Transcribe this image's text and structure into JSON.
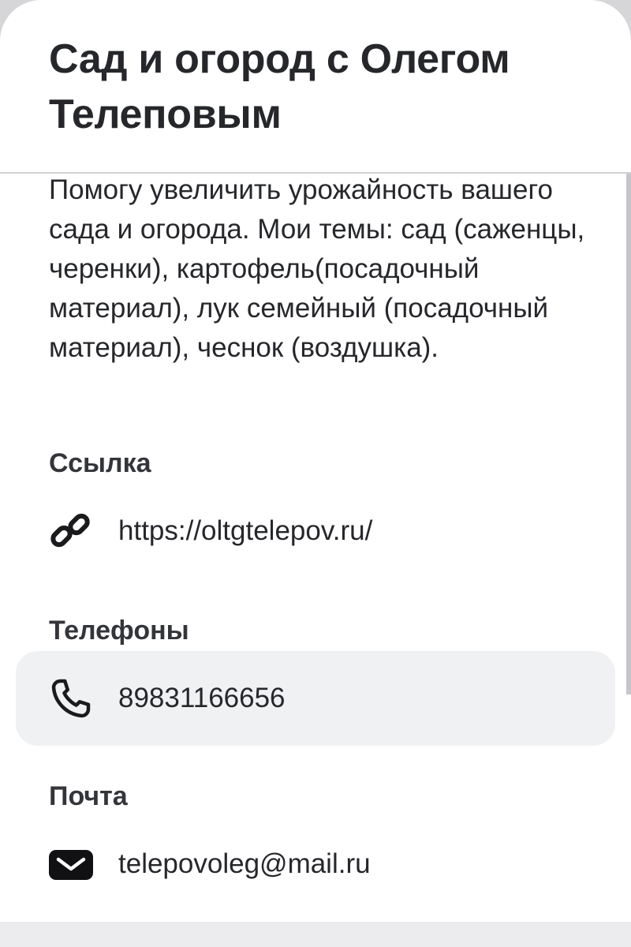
{
  "profile": {
    "title": "Сад и огород с Олегом Телеповым",
    "description": "Помогу увеличить урожайность вашего сада и огорода. Мои темы: сад (саженцы, черенки), картофель(посадочный материал), лук семейный (посадочный материал), чеснок (воздушка)."
  },
  "contacts": {
    "link": {
      "label": "Ссылка",
      "value": "https://oltgtelepov.ru/",
      "icon": "link-icon"
    },
    "phones": {
      "label": "Телефоны",
      "value": "89831166656",
      "icon": "phone-icon"
    },
    "email": {
      "label": "Почта",
      "value": "telepovoleg@mail.ru",
      "icon": "mail-icon"
    }
  },
  "colors": {
    "text": "#26272b",
    "highlight_row": "#f0f1f3",
    "divider": "#d2d2d6"
  }
}
